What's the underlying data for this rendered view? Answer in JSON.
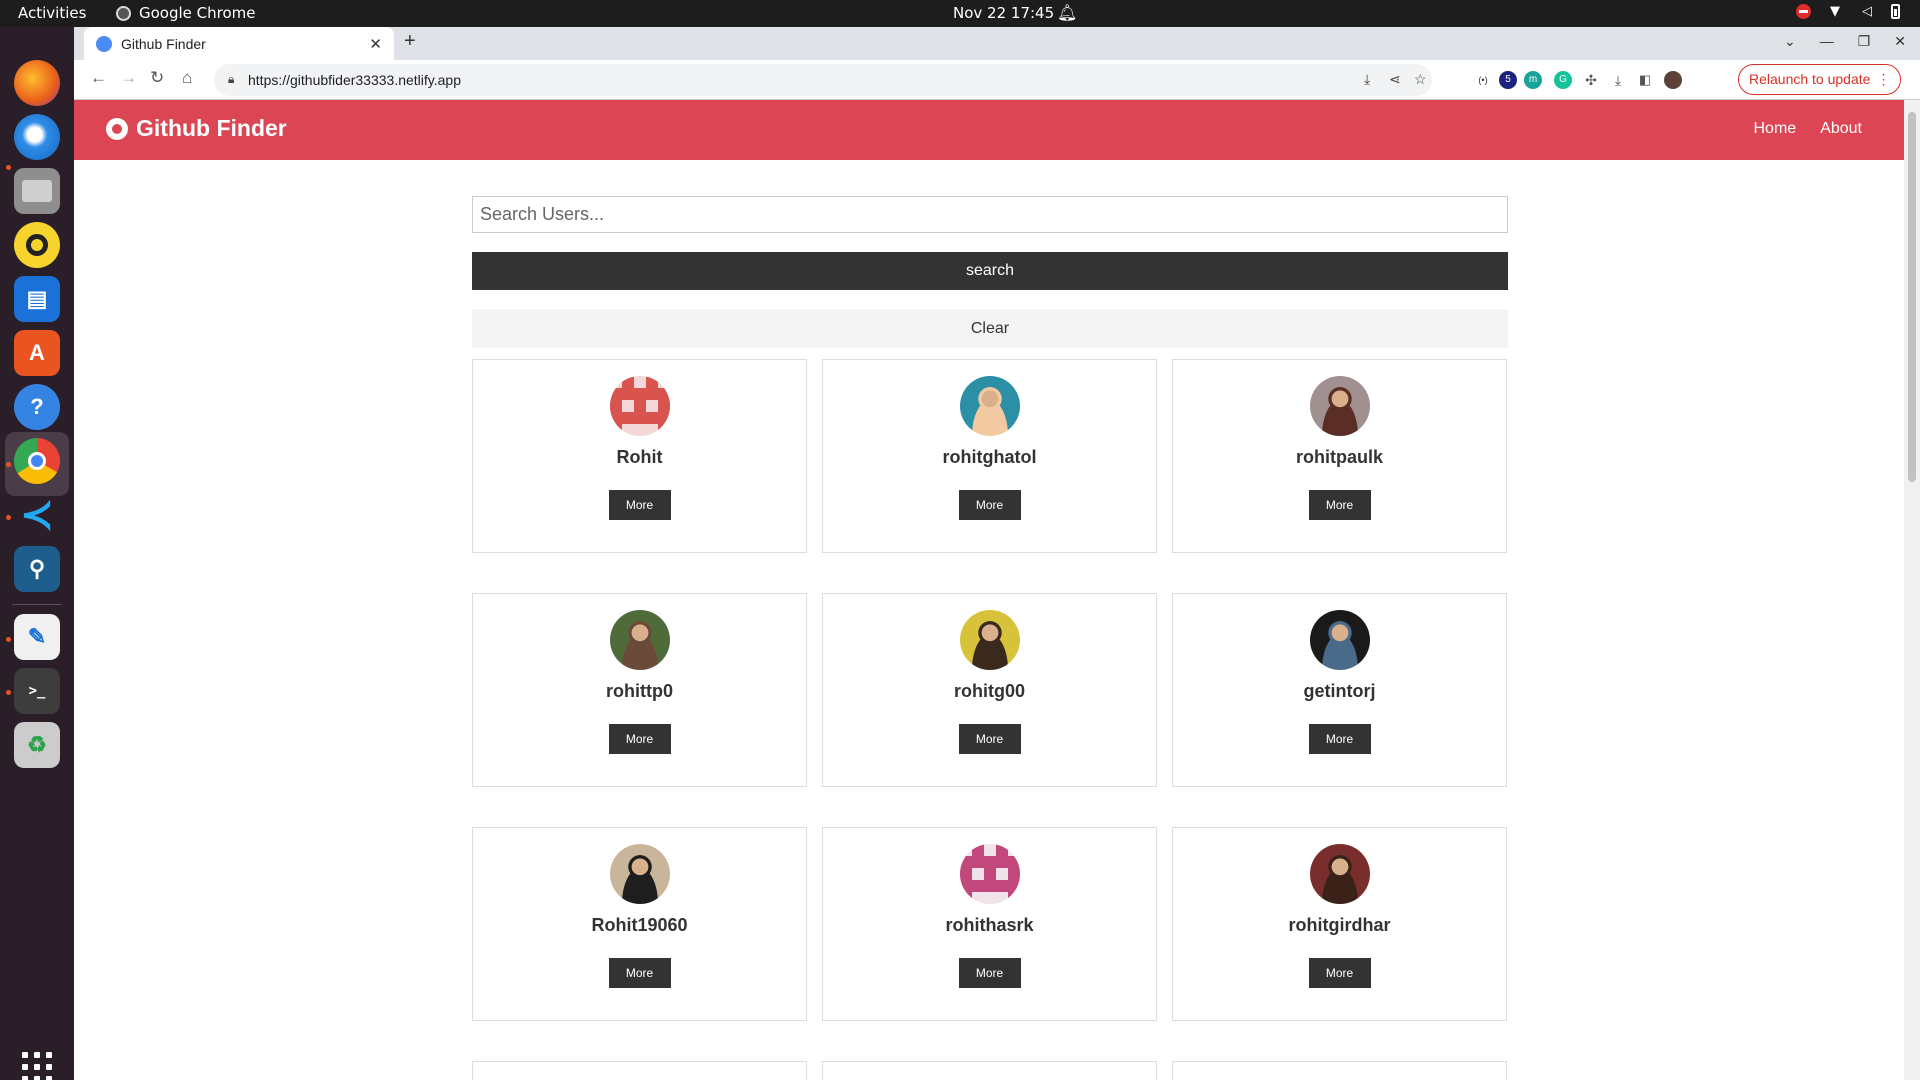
{
  "system": {
    "activities": "Activities",
    "app_name": "Google Chrome",
    "date_time": "Nov 22  17:45"
  },
  "browser": {
    "tab_title": "Github Finder",
    "url": "https://githubfider33333.netlify.app",
    "relaunch_label": "Relaunch to update",
    "extension_badge": "5"
  },
  "site": {
    "brand": "Github Finder",
    "nav": [
      "Home",
      "About"
    ],
    "accent_color": "#dc4654"
  },
  "search": {
    "placeholder": "Search Users...",
    "value": "",
    "search_label": "search",
    "clear_label": "Clear"
  },
  "users": [
    {
      "login": "Rohit",
      "more": "More",
      "avatar": {
        "bg": "#f4d7d7",
        "fg": "#d9534f",
        "type": "identicon"
      }
    },
    {
      "login": "rohitghatol",
      "more": "More",
      "avatar": {
        "bg": "#2b8fa6",
        "fg": "#f2c9a0",
        "type": "photo"
      }
    },
    {
      "login": "rohitpaulk",
      "more": "More",
      "avatar": {
        "bg": "#a09090",
        "fg": "#5a2e24",
        "type": "photo"
      }
    },
    {
      "login": "rohittp0",
      "more": "More",
      "avatar": {
        "bg": "#4f6b3a",
        "fg": "#6b4a3a",
        "type": "photo"
      }
    },
    {
      "login": "rohitg00",
      "more": "More",
      "avatar": {
        "bg": "#d8c23a",
        "fg": "#3a2a1e",
        "type": "photo"
      }
    },
    {
      "login": "getintorj",
      "more": "More",
      "avatar": {
        "bg": "#1a1a1a",
        "fg": "#4a6a8a",
        "type": "photo"
      }
    },
    {
      "login": "Rohit19060",
      "more": "More",
      "avatar": {
        "bg": "#c9b59a",
        "fg": "#1e1e1e",
        "type": "photo"
      }
    },
    {
      "login": "rohithasrk",
      "more": "More",
      "avatar": {
        "bg": "#f1e3ea",
        "fg": "#c2477a",
        "type": "identicon"
      }
    },
    {
      "login": "rohitgirdhar",
      "more": "More",
      "avatar": {
        "bg": "#7a2d2d",
        "fg": "#3a2218",
        "type": "photo"
      }
    }
  ]
}
